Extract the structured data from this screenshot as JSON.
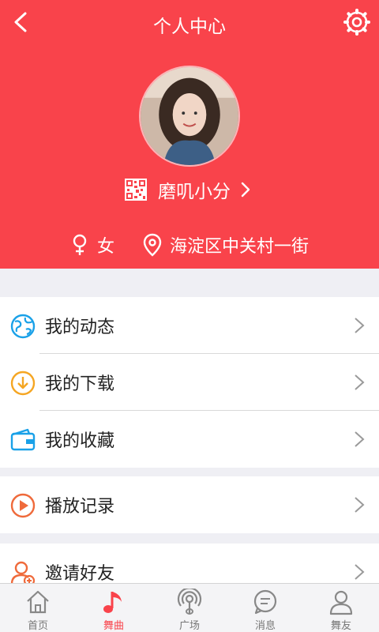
{
  "header": {
    "title": "个人中心",
    "accent_color": "#f9434b"
  },
  "profile": {
    "name": "磨叽小分",
    "gender": "女",
    "location": "海淀区中关村一街"
  },
  "menu_groups": [
    [
      {
        "label": "我的动态",
        "icon": "globe-icon",
        "icon_color": "#1aa1e8"
      },
      {
        "label": "我的下载",
        "icon": "download-icon",
        "icon_color": "#f5a623"
      },
      {
        "label": "我的收藏",
        "icon": "wallet-icon",
        "icon_color": "#1aa1e8"
      }
    ],
    [
      {
        "label": "播放记录",
        "icon": "play-icon",
        "icon_color": "#ef6a3b"
      }
    ],
    [
      {
        "label": "邀请好友",
        "icon": "add-user-icon",
        "icon_color": "#ef6a3b"
      }
    ]
  ],
  "tabs": [
    {
      "label": "首页",
      "icon": "home-icon",
      "active": false
    },
    {
      "label": "舞曲",
      "icon": "music-note-icon",
      "active": true
    },
    {
      "label": "广场",
      "icon": "broadcast-icon",
      "active": false
    },
    {
      "label": "消息",
      "icon": "message-icon",
      "active": false
    },
    {
      "label": "舞友",
      "icon": "friend-icon",
      "active": false
    }
  ]
}
